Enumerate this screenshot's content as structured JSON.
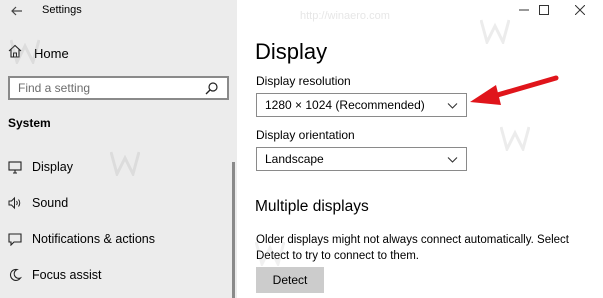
{
  "window": {
    "title": "Settings",
    "back_icon": "back-arrow-icon",
    "controls": [
      "minimize-icon",
      "maximize-icon",
      "close-icon"
    ]
  },
  "nav": {
    "home_label": "Home",
    "search_placeholder": "Find a setting",
    "section_label": "System",
    "items": [
      {
        "label": "Display",
        "icon": "monitor-icon"
      },
      {
        "label": "Sound",
        "icon": "speaker-icon"
      },
      {
        "label": "Notifications & actions",
        "icon": "notification-icon"
      },
      {
        "label": "Focus assist",
        "icon": "moon-icon"
      }
    ]
  },
  "main": {
    "title": "Display",
    "resolution": {
      "label": "Display resolution",
      "value": "1280 × 1024 (Recommended)"
    },
    "orientation": {
      "label": "Display orientation",
      "value": "Landscape"
    },
    "multiple_displays": {
      "heading": "Multiple displays",
      "description": "Older displays might not always connect automatically. Select Detect to try to connect to them.",
      "detect_label": "Detect"
    }
  },
  "watermark_text": "http://winaero.com",
  "colors": {
    "nav_bg": "#ececec",
    "annotation_arrow": "#e0151b",
    "button_bg": "#cccccc"
  }
}
